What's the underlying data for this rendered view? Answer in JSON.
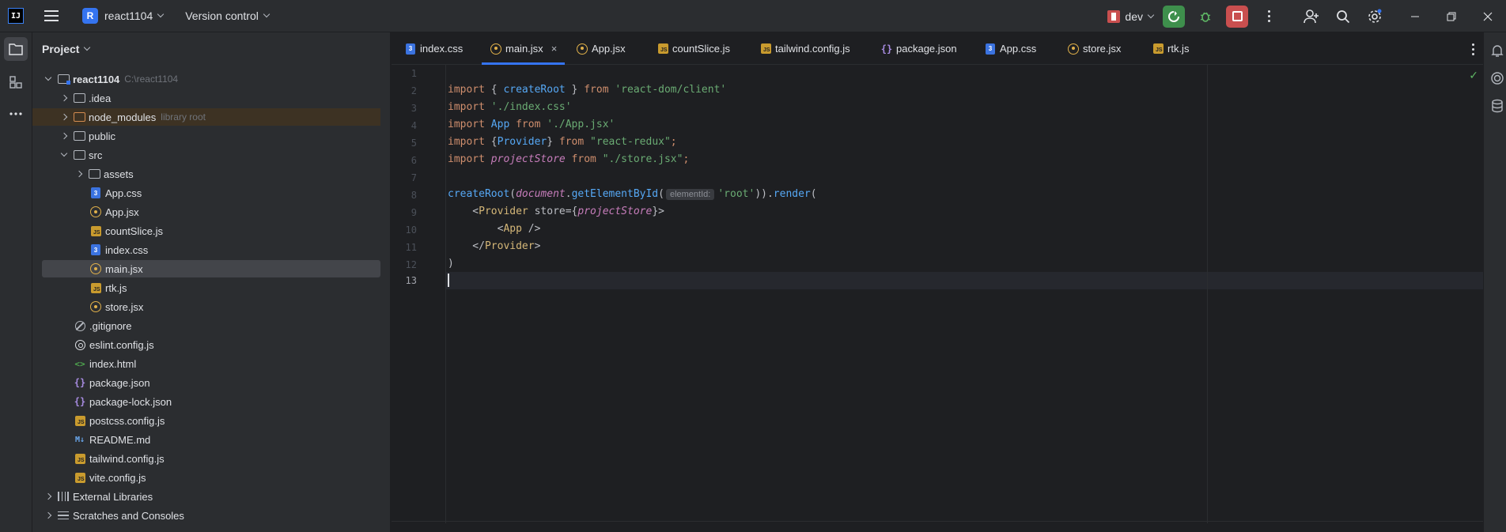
{
  "titlebar": {
    "app_logo": "IJ",
    "project_badge": "R",
    "project_name": "react1104",
    "version_control": "Version control",
    "run_config": "dev"
  },
  "project_panel": {
    "title": "Project",
    "root": {
      "name": "react1104",
      "path": "C:\\react1104"
    },
    "node_modules_note": "library root",
    "items": [
      ".idea",
      "node_modules",
      "public",
      "src",
      "assets",
      "App.css",
      "App.jsx",
      "countSlice.js",
      "index.css",
      "main.jsx",
      "rtk.js",
      "store.jsx",
      ".gitignore",
      "eslint.config.js",
      "index.html",
      "package.json",
      "package-lock.json",
      "postcss.config.js",
      "README.md",
      "tailwind.config.js",
      "vite.config.js",
      "External Libraries",
      "Scratches and Consoles"
    ]
  },
  "tabs": [
    "index.css",
    "main.jsx",
    "App.jsx",
    "countSlice.js",
    "tailwind.config.js",
    "package.json",
    "App.css",
    "store.jsx",
    "rtk.js"
  ],
  "tab_close": "×",
  "editor": {
    "line_numbers": [
      "1",
      "2",
      "3",
      "4",
      "5",
      "6",
      "7",
      "8",
      "9",
      "10",
      "11",
      "12",
      "13"
    ],
    "l2": {
      "a": "import",
      "b": " { ",
      "c": "createRoot",
      "d": " } ",
      "e": "from",
      "f": " ",
      "g": "'react-dom/client'"
    },
    "l3": {
      "a": "import",
      "b": " ",
      "c": "'./index.css'"
    },
    "l4": {
      "a": "import",
      "b": " ",
      "c": "App",
      "d": " ",
      "e": "from",
      "f": " ",
      "g": "'./App.jsx'"
    },
    "l5": {
      "a": "import",
      "b": " {",
      "c": "Provider",
      "d": "} ",
      "e": "from",
      "f": " ",
      "g": "\"react-redux\"",
      "h": ";"
    },
    "l6": {
      "a": "import",
      "b": " ",
      "c": "projectStore",
      "d": " ",
      "e": "from",
      "f": " ",
      "g": "\"./store.jsx\"",
      "h": ";"
    },
    "l8": {
      "a": "createRoot",
      "b": "(",
      "c": "document",
      "d": ".",
      "e": "getElementById",
      "f": "(",
      "hint": "elementId:",
      "g": "'root'",
      "h": ")).",
      "i": "render",
      "j": "("
    },
    "l9": {
      "a": "    <",
      "b": "Provider",
      "c": " store={",
      "d": "projectStore",
      "e": "}>"
    },
    "l10": {
      "a": "        <",
      "b": "App",
      "c": " />"
    },
    "l11": {
      "a": "    </",
      "b": "Provider",
      "c": ">"
    },
    "l12": {
      "a": ")"
    }
  },
  "colors": {
    "accent": "#3574f0",
    "keyword": "#cf8e6d",
    "string": "#6aab73",
    "function": "#56a8f5",
    "italic_var": "#c77dbb",
    "jsx_tag": "#d5b778"
  }
}
